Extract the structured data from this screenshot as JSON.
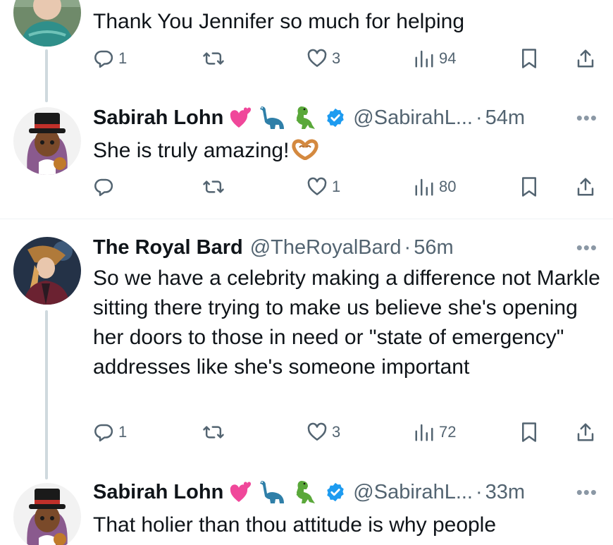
{
  "tweets": [
    {
      "name": "",
      "handle": "",
      "time": "",
      "text": "Thank You Jennifer so much for helping",
      "replies": "1",
      "retweets": "",
      "likes": "3",
      "views": "94"
    },
    {
      "name": "Sabirah Lohn",
      "handle": "@SabirahL...",
      "time": "54m",
      "text": "She is truly amazing!",
      "replies": "",
      "retweets": "",
      "likes": "1",
      "views": "80"
    },
    {
      "name": "The Royal Bard",
      "handle": "@TheRoyalBard",
      "time": "56m",
      "text": "So we have a celebrity making a difference not Markle sitting there trying to make us believe she's opening her doors to those in need or \"state of emergency\" addresses like she's someone important",
      "replies": "1",
      "retweets": "",
      "likes": "3",
      "views": "72"
    },
    {
      "name": "Sabirah Lohn",
      "handle": "@SabirahL...",
      "time": "33m",
      "text": "That holier than thou attitude is why people"
    }
  ],
  "ui": {
    "dot": "·",
    "more": "•••"
  },
  "colors": {
    "text": "#0f1419",
    "secondary": "#536471",
    "verified": "#1d9bf0",
    "thread_line": "#cfd9de"
  },
  "icons": [
    "reply-icon",
    "retweet-icon",
    "like-icon",
    "views-icon",
    "bookmark-icon",
    "share-icon",
    "verified-badge-icon",
    "more-icon",
    "heart-emoji",
    "sauropod-emoji",
    "t-rex-emoji",
    "heart-hands-emoji"
  ]
}
